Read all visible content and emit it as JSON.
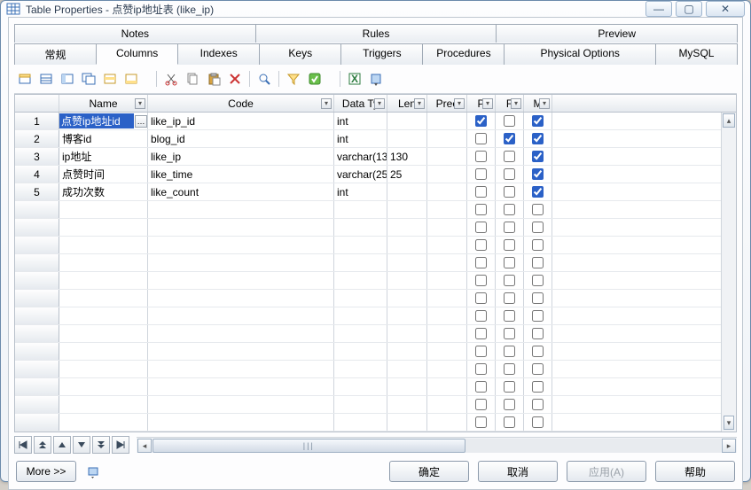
{
  "window": {
    "title": "Table Properties - 点赞ip地址表 (like_ip)"
  },
  "winbtns": {
    "min": "—",
    "max": "▢",
    "close": "✕"
  },
  "tabs_top": [
    {
      "label": "Notes"
    },
    {
      "label": "Rules"
    },
    {
      "label": "Preview"
    }
  ],
  "tabs_bottom": [
    {
      "label": "常规"
    },
    {
      "label": "Columns"
    },
    {
      "label": "Indexes"
    },
    {
      "label": "Keys"
    },
    {
      "label": "Triggers"
    },
    {
      "label": "Procedures"
    },
    {
      "label": "Physical Options"
    },
    {
      "label": "MySQL"
    }
  ],
  "grid": {
    "headers": {
      "name": "Name",
      "code": "Code",
      "data_type": "Data Ty",
      "length": "Len",
      "precision": "Prec",
      "p": "P",
      "f": "F",
      "m": "M"
    },
    "rows": [
      {
        "idx": "1",
        "name": "点赞ip地址id",
        "code": "like_ip_id",
        "data_type": "int",
        "length": "",
        "precision": "",
        "p": true,
        "f": false,
        "m": true,
        "f_shaded": true,
        "selected": true
      },
      {
        "idx": "2",
        "name": "博客id",
        "code": "blog_id",
        "data_type": "int",
        "length": "",
        "precision": "",
        "p": false,
        "f": true,
        "m": true,
        "f_shaded": false
      },
      {
        "idx": "3",
        "name": "ip地址",
        "code": "like_ip",
        "data_type": "varchar(13",
        "length": "130",
        "precision": "",
        "p": false,
        "f": false,
        "m": true,
        "f_shaded": true
      },
      {
        "idx": "4",
        "name": "点赞时间",
        "code": "like_time",
        "data_type": "varchar(25",
        "length": "25",
        "precision": "",
        "p": false,
        "f": false,
        "m": true,
        "f_shaded": true
      },
      {
        "idx": "5",
        "name": "成功次数",
        "code": "like_count",
        "data_type": "int",
        "length": "",
        "precision": "",
        "p": false,
        "f": false,
        "m": true,
        "f_shaded": true
      }
    ],
    "empty_rows": 13
  },
  "footer": {
    "more": "More >>",
    "ok": "确定",
    "cancel": "取消",
    "apply": "应用(A)",
    "help": "帮助"
  },
  "nav_icons": [
    "⤒",
    "↑",
    "↑",
    "↓",
    "↓",
    "⤓"
  ],
  "toolbar_icons": [
    "grid-new",
    "grid-open",
    "grid-props",
    "grid-clone",
    "grid-insert",
    "grid-append",
    "cut",
    "copy",
    "paste",
    "delete",
    "find",
    "filter",
    "check",
    "wizard",
    "excel",
    "tools"
  ]
}
